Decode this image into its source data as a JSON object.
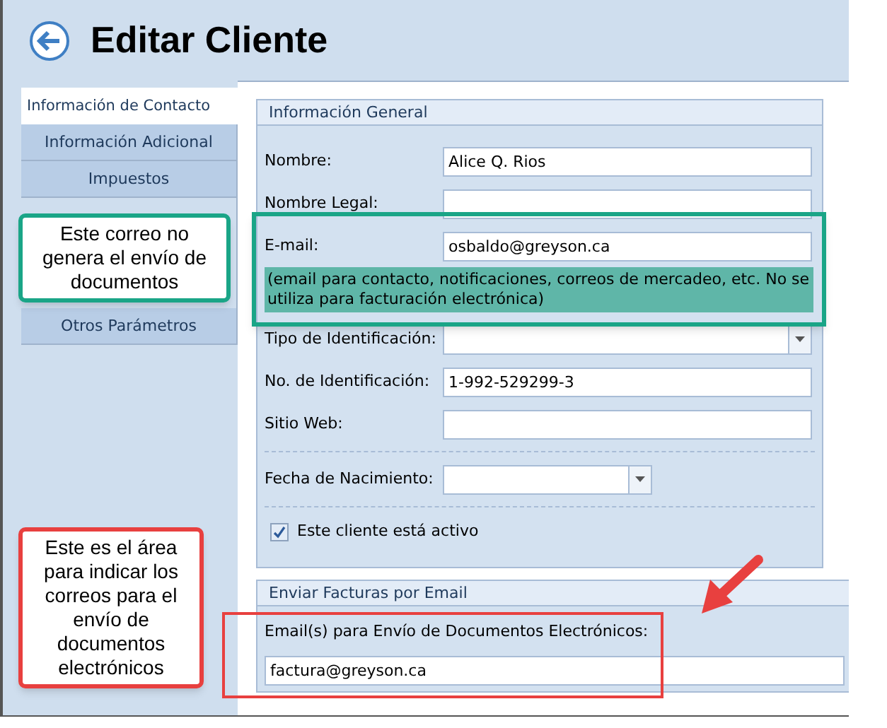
{
  "window": {
    "title": "Editar Cliente"
  },
  "sidebar": {
    "tabs": [
      {
        "label": "Información de Contacto",
        "selected": true
      },
      {
        "label": "Información Adicional",
        "selected": false
      },
      {
        "label": "Impuestos",
        "selected": false
      },
      {
        "label": "Otros Parámetros",
        "selected": false
      }
    ]
  },
  "general": {
    "title": "Información General",
    "fields": [
      {
        "kind": "text",
        "label": "Nombre:",
        "value": "Alice Q. Rios"
      },
      {
        "kind": "text",
        "label": "Nombre Legal:"
      },
      {
        "kind": "text",
        "label": "E-mail:",
        "value": "osbaldo@greyson.ca",
        "note": "(email para contacto, notificaciones, correos de mercadeo, etc. No se utiliza para facturación electrónica)"
      },
      {
        "kind": "combo",
        "label": "Tipo de Identificación:"
      },
      {
        "kind": "text",
        "label": "No. de Identificación:",
        "value": "1-992-529299-3"
      },
      {
        "kind": "text",
        "label": "Sitio Web:"
      },
      {
        "kind": "date",
        "label": "Fecha de Nacimiento:"
      },
      {
        "kind": "check",
        "label": "Este cliente está activo",
        "checked": true
      }
    ]
  },
  "invoices": {
    "title": "Enviar Facturas por Email",
    "label": "Email(s) para Envío de Documentos Electrónicos:",
    "value": "factura@greyson.ca"
  },
  "annotations": [
    {
      "kind": "green",
      "text": "Este correo no genera el envío de documentos"
    },
    {
      "kind": "red",
      "text": "Este es el área para indicar los correos para el envío de documentos electrónicos"
    }
  ]
}
